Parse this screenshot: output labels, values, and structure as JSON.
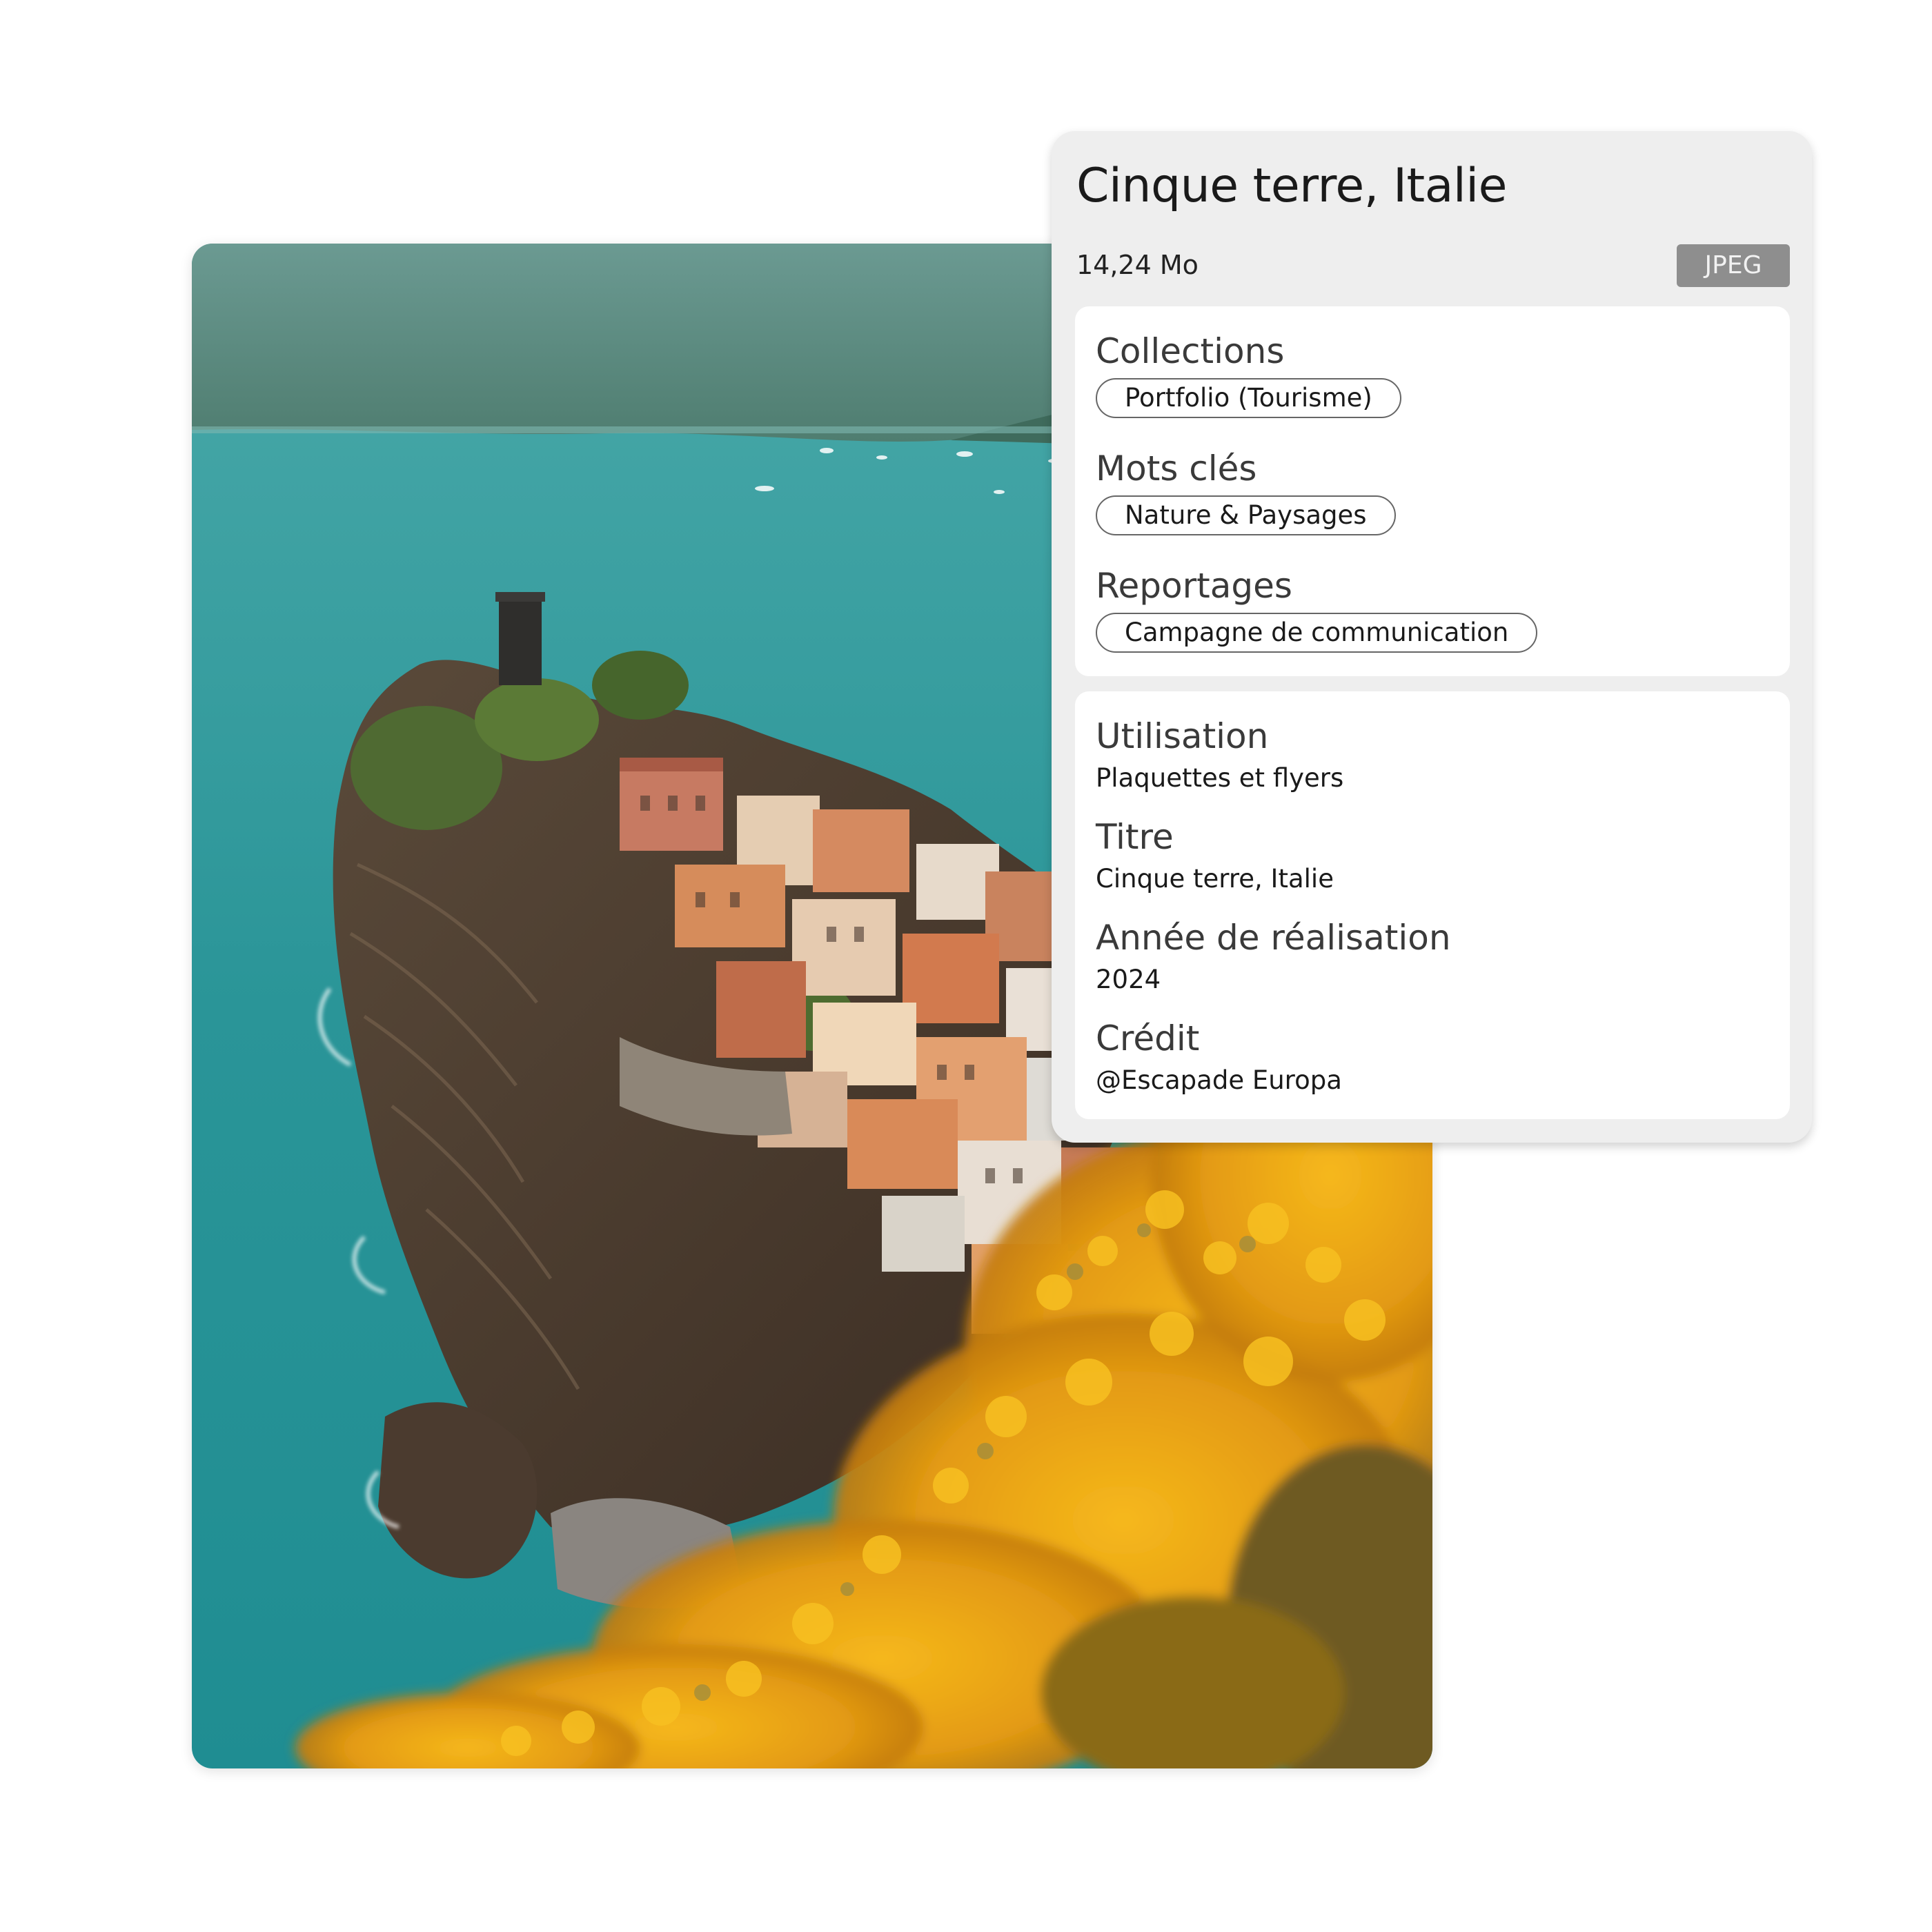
{
  "asset": {
    "title": "Cinque terre, Italie",
    "file_size": "14,24 Mo",
    "format": "JPEG",
    "image_subject": "coastal-village-photo"
  },
  "tags": {
    "collections": {
      "label": "Collections",
      "value": "Portfolio (Tourisme)"
    },
    "keywords": {
      "label": "Mots clés",
      "value": "Nature & Paysages"
    },
    "reports": {
      "label": "Reportages",
      "value": "Campagne de communication"
    }
  },
  "metadata": {
    "usage": {
      "label": "Utilisation",
      "value": "Plaquettes et flyers"
    },
    "title": {
      "label": "Titre",
      "value": "Cinque terre, Italie"
    },
    "year": {
      "label": "Année de réalisation",
      "value": "2024"
    },
    "credit": {
      "label": "Crédit",
      "value": "@Escapade Europa"
    }
  },
  "colors": {
    "panel_bg": "#eeeeee",
    "card_bg": "#ffffff",
    "badge_bg": "#8e8e8e",
    "sea": "#2f9a9c",
    "flowers": "#e8a317"
  }
}
